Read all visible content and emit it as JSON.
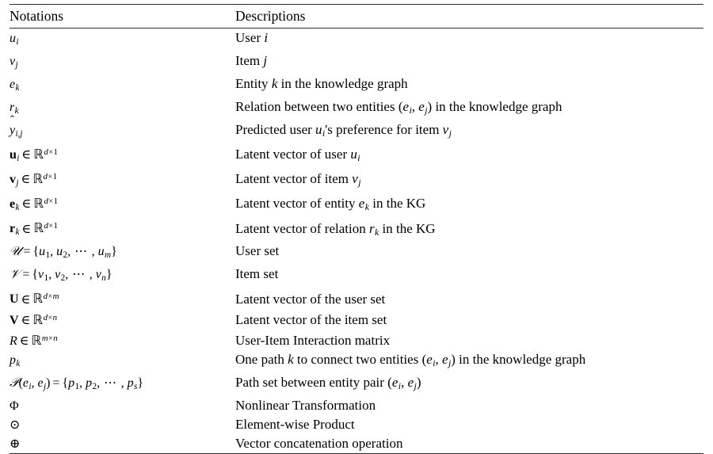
{
  "table": {
    "headers": {
      "notation": "Notations",
      "description": "Descriptions"
    },
    "rows": [
      {
        "notation_plain": "u_i",
        "description_plain": "User i"
      },
      {
        "notation_plain": "v_j",
        "description_plain": "Item j"
      },
      {
        "notation_plain": "e_k",
        "description_plain": "Entity k in the knowledge graph"
      },
      {
        "notation_plain": "r_k",
        "description_plain": "Relation between two entities (e_i, e_j) in the knowledge graph"
      },
      {
        "notation_plain": "y-hat_{i,j}",
        "description_plain": "Predicted user u_i's preference for item v_j"
      },
      {
        "notation_plain": "u_i in R^{d x 1}",
        "description_plain": "Latent vector of user u_i"
      },
      {
        "notation_plain": "v_j in R^{d x 1}",
        "description_plain": "Latent vector of item v_j"
      },
      {
        "notation_plain": "e_k in R^{d x 1}",
        "description_plain": "Latent vector of entity e_k in the KG"
      },
      {
        "notation_plain": "r_k in R^{d x 1}",
        "description_plain": "Latent vector of relation r_k in the KG"
      },
      {
        "notation_plain": "U = {u_1, u_2, ..., u_m}",
        "description_plain": "User set"
      },
      {
        "notation_plain": "V = {v_1, v_2, ..., v_n}",
        "description_plain": "Item set"
      },
      {
        "notation_plain": "U in R^{d x m}",
        "description_plain": "Latent vector of the user set"
      },
      {
        "notation_plain": "V in R^{d x n}",
        "description_plain": "Latent vector of the item set"
      },
      {
        "notation_plain": "R in R^{m x n}",
        "description_plain": "User-Item Interaction matrix"
      },
      {
        "notation_plain": "p_k",
        "description_plain": "One path k to connect two entities (e_i, e_j) in the knowledge graph"
      },
      {
        "notation_plain": "P(e_i, e_j) = {p_1, p_2, ..., p_s}",
        "description_plain": "Path set between entity pair (e_i, e_j)"
      },
      {
        "notation_plain": "Phi",
        "description_plain": "Nonlinear Transformation"
      },
      {
        "notation_plain": "odot",
        "description_plain": "Element-wise Product"
      },
      {
        "notation_plain": "oplus",
        "description_plain": "Vector concatenation operation"
      }
    ],
    "description_texts": {
      "user_i_prefix": "User",
      "item_j_prefix": "Item",
      "entity_k_prefix": "Entity",
      "entity_k_suffix": "in the knowledge graph",
      "relation_prefix": "Relation between two entities",
      "relation_suffix": "in the knowledge graph",
      "predicted_prefix": "Predicted user",
      "predicted_mid": "'s preference for item",
      "latent_user": "Latent vector of user",
      "latent_item": "Latent vector of item",
      "latent_entity_prefix": "Latent vector of entity",
      "latent_entity_suffix": "in the KG",
      "latent_relation_prefix": "Latent vector of relation",
      "latent_relation_suffix": "in the KG",
      "user_set": "User set",
      "item_set": "Item set",
      "latent_user_set": "Latent vector of the user set",
      "latent_item_set": "Latent vector of the item set",
      "interaction_matrix": "User-Item Interaction matrix",
      "one_path_prefix": "One path",
      "one_path_mid": "to connect two entities",
      "one_path_suffix": "in the knowledge graph",
      "path_set_prefix": "Path set between entity pair",
      "nonlinear_transformation": "Nonlinear Transformation",
      "elementwise_product": "Element-wise Product",
      "vector_concatenation": "Vector concatenation operation"
    },
    "symbols": {
      "u": "u",
      "v": "v",
      "e": "e",
      "r": "r",
      "p": "p",
      "R_italic": "R",
      "i": "i",
      "j": "j",
      "k": "k",
      "m": "m",
      "n": "n",
      "s": "s",
      "d": "d",
      "one": "1",
      "two": "2",
      "y": "y",
      "hat": "̂",
      "comma": ",",
      "in": "∈",
      "blackboard_R": "ℝ",
      "times": "×",
      "cal_U": "𝒰",
      "cal_V": "𝒱",
      "cal_P": "𝒫",
      "bold_U": "U",
      "bold_V": "V",
      "phi": "Φ",
      "odot": "⊙",
      "oplus": "⊕",
      "equals": "=",
      "lbrace": "{",
      "rbrace": "}",
      "lparen": "(",
      "rparen": ")",
      "cdots": "⋯",
      "apostrophe": "′"
    },
    "colors": {
      "text": "#000000",
      "rule": "#2b2b2b",
      "background": "#ffffff"
    }
  }
}
